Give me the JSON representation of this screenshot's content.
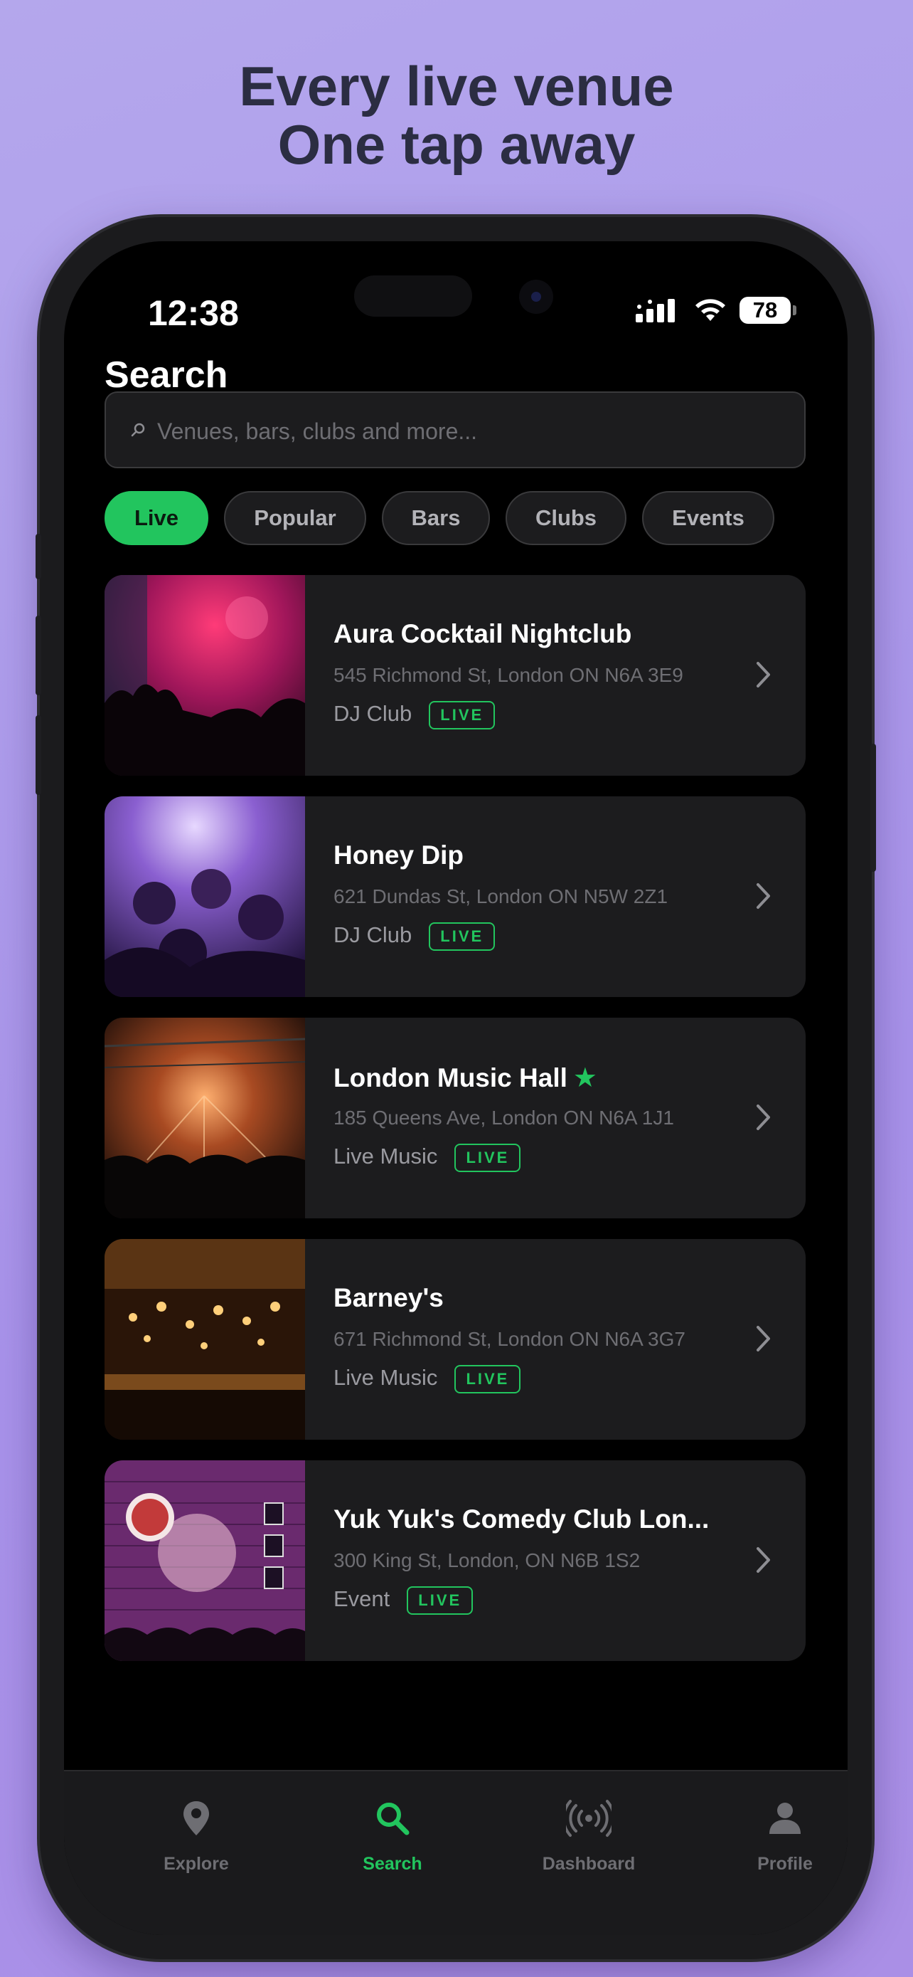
{
  "headline": {
    "line1": "Every live venue",
    "line2": "One tap away"
  },
  "status_bar": {
    "time": "12:38",
    "battery": "78"
  },
  "page_title": "Search",
  "search": {
    "placeholder": "Venues, bars, clubs and more...",
    "value": ""
  },
  "filters": [
    {
      "label": "Live",
      "active": true
    },
    {
      "label": "Popular",
      "active": false
    },
    {
      "label": "Bars",
      "active": false
    },
    {
      "label": "Clubs",
      "active": false
    },
    {
      "label": "Events",
      "active": false
    }
  ],
  "venues": [
    {
      "name": "Aura Cocktail Nightclub",
      "address": "545 Richmond St, London ON N6A 3E9",
      "category": "DJ Club",
      "badge": "LIVE",
      "featured": false
    },
    {
      "name": "Honey Dip",
      "address": "621 Dundas St, London ON N5W 2Z1",
      "category": "DJ Club",
      "badge": "LIVE",
      "featured": false
    },
    {
      "name": "London Music Hall",
      "address": "185 Queens Ave, London ON N6A 1J1",
      "category": "Live Music",
      "badge": "LIVE",
      "featured": true
    },
    {
      "name": "Barney's",
      "address": "671 Richmond St, London ON N6A 3G7",
      "category": "Live Music",
      "badge": "LIVE",
      "featured": false
    },
    {
      "name": "Yuk Yuk's Comedy Club Lon...",
      "address": "300 King St, London, ON N6B 1S2",
      "category": "Event",
      "badge": "LIVE",
      "featured": false
    }
  ],
  "tabs": [
    {
      "label": "Explore",
      "icon": "map-pin-icon",
      "active": false
    },
    {
      "label": "Search",
      "icon": "search-icon",
      "active": true
    },
    {
      "label": "Dashboard",
      "icon": "broadcast-icon",
      "active": false
    },
    {
      "label": "Profile",
      "icon": "person-icon",
      "active": false
    }
  ],
  "colors": {
    "accent": "#22c55e",
    "background": "#000000",
    "card": "#1c1c1e",
    "backdrop": "#ab94ea"
  }
}
